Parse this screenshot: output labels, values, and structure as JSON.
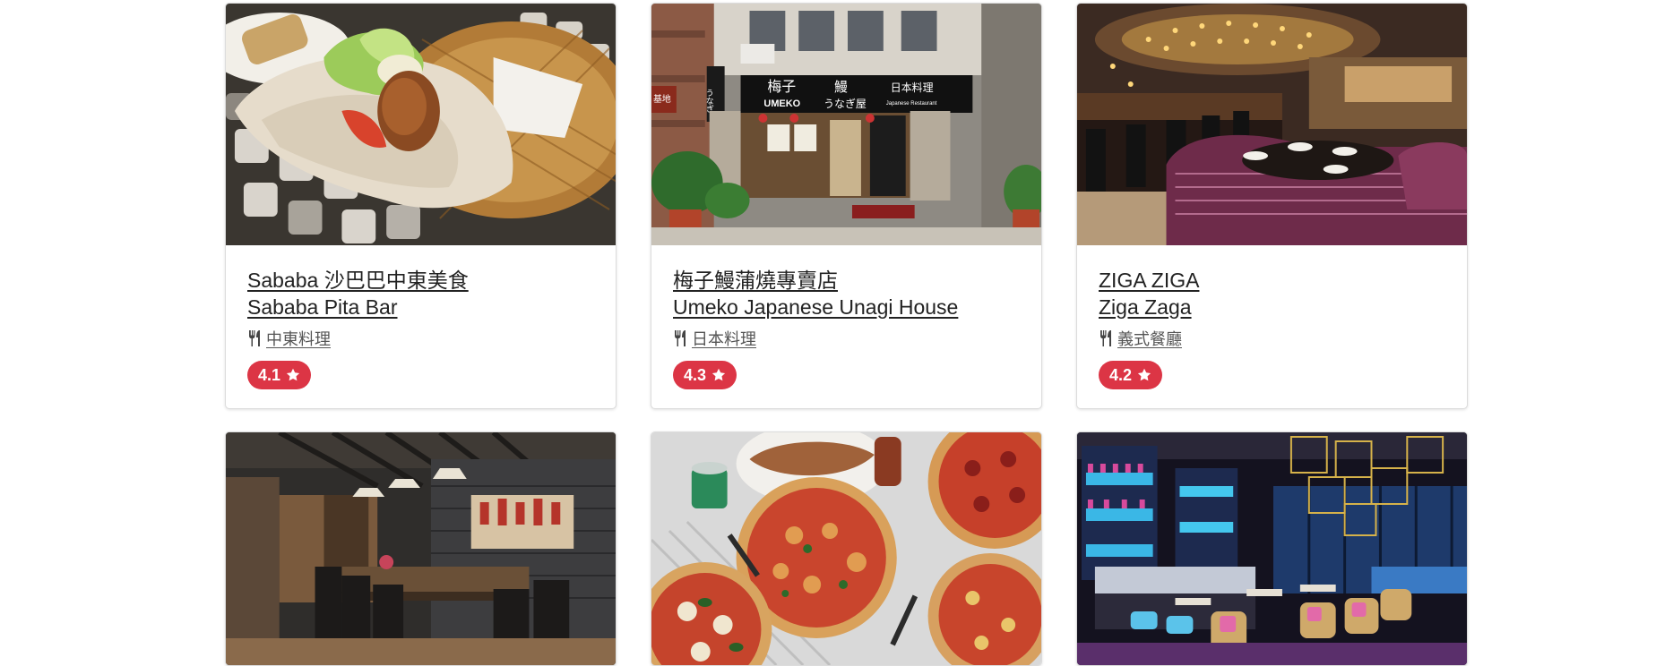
{
  "colors": {
    "rating_badge": "#dc3545",
    "title_text": "#222222",
    "category_text": "#555555"
  },
  "restaurants": [
    {
      "name_zh": "Sababa 沙巴巴中東美食",
      "name_en": "Sababa Pita Bar",
      "category": "中東料理",
      "rating": "4.1",
      "category_icon": "utensils-icon",
      "rating_icon": "star-icon"
    },
    {
      "name_zh": "梅子鰻蒲燒專賣店",
      "name_en": "Umeko Japanese Unagi House",
      "category": "日本料理",
      "rating": "4.3",
      "category_icon": "utensils-icon",
      "rating_icon": "star-icon"
    },
    {
      "name_zh": "ZIGA ZIGA",
      "name_en": "Ziga Zaga",
      "category": "義式餐廳",
      "rating": "4.2",
      "category_icon": "utensils-icon",
      "rating_icon": "star-icon"
    }
  ],
  "signage": {
    "umeko_main": "梅子",
    "umeko_eel": "鰻",
    "umeko_roman": "UMEKO",
    "umeko_kana": "うなぎ屋",
    "umeko_jp": "日本料理",
    "umeko_en": "Japanese Restaurant",
    "side_sign": "うなぎ",
    "left_sign": "基地"
  }
}
